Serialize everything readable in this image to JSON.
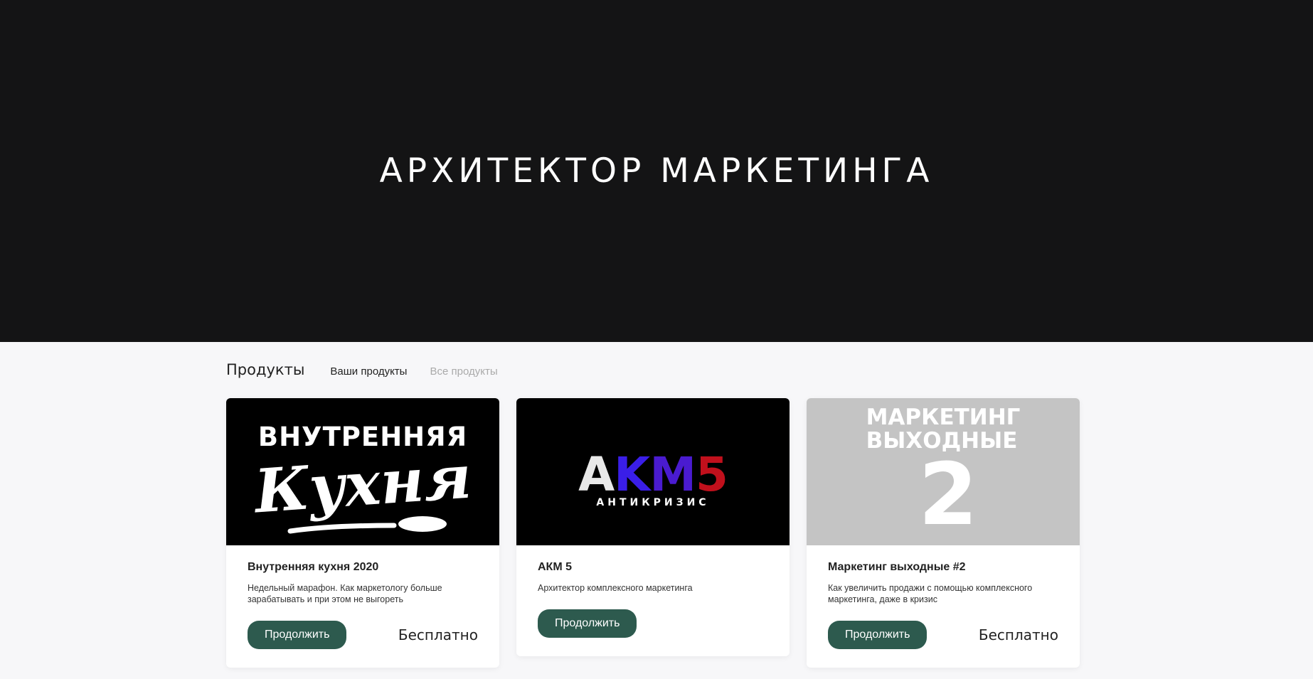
{
  "hero": {
    "title": "АРХИТЕКТОР МАРКЕТИНГА"
  },
  "products": {
    "section_title": "Продукты",
    "tabs": [
      {
        "label": "Ваши продукты"
      },
      {
        "label": "Все продукты"
      }
    ],
    "cards": [
      {
        "cover_line1": "ВНУТРЕННЯЯ",
        "cover_line2": "Кухня",
        "title": "Внутренняя кухня 2020",
        "description": "Недельный марафон. Как маркетологу больше зарабатывать и при этом не выгореть",
        "button_label": "Продолжить",
        "price": "Бесплатно"
      },
      {
        "cover_a": "A",
        "cover_k": "K",
        "cover_m": "M",
        "cover_n": "5",
        "cover_sub": "АНТИКРИЗИС",
        "title": "АКМ 5",
        "description": "Архитектор комплексного маркетинга",
        "button_label": "Продолжить",
        "price": ""
      },
      {
        "cover_line1": "МАРКЕТИНГ",
        "cover_line2": "ВЫХОДНЫЕ",
        "cover_number": "2",
        "title": "Маркетинг выходные #2",
        "description": "Как увеличить продажи с помощью комплексного маркетинга, даже в кризис",
        "button_label": "Продолжить",
        "price": "Бесплатно"
      }
    ]
  },
  "colors": {
    "hero_bg": "#141415",
    "page_bg": "#f7f7f9",
    "button_bg": "#2d5a4e",
    "cover3_bg": "#c4c4c4"
  }
}
